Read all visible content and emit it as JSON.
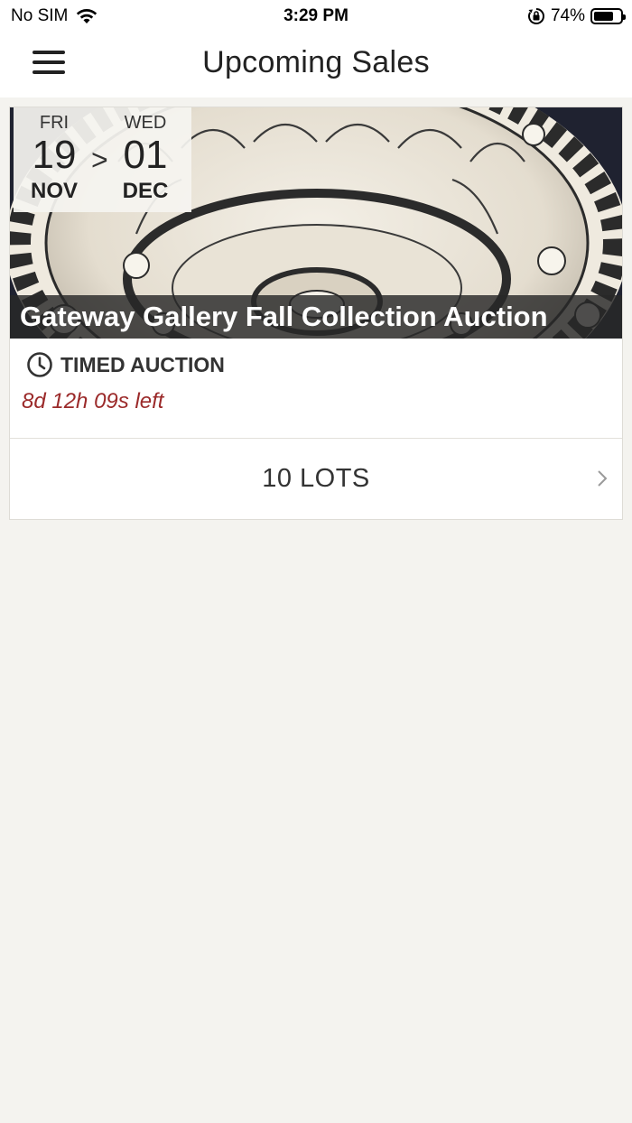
{
  "status_bar": {
    "carrier": "No SIM",
    "time": "3:29 PM",
    "battery_percent": "74%",
    "battery_level": 0.74
  },
  "nav": {
    "title": "Upcoming Sales",
    "menu_icon": "hamburger-menu-icon"
  },
  "sales": [
    {
      "start": {
        "day_of_week": "FRI",
        "day": "19",
        "month": "NOV"
      },
      "separator": ">",
      "end": {
        "day_of_week": "WED",
        "day": "01",
        "month": "DEC"
      },
      "title": "Gateway Gallery Fall Collection Auction",
      "type": "TIMED AUCTION",
      "type_icon": "clock-icon",
      "time_left": "8d 12h 09s left",
      "lots": "10 LOTS",
      "image_description_icon": "ceramic-bowl-image"
    }
  ],
  "colors": {
    "background": "#f4f3ef",
    "time_left": "#9b2a2a",
    "title_bar": "#282828"
  }
}
